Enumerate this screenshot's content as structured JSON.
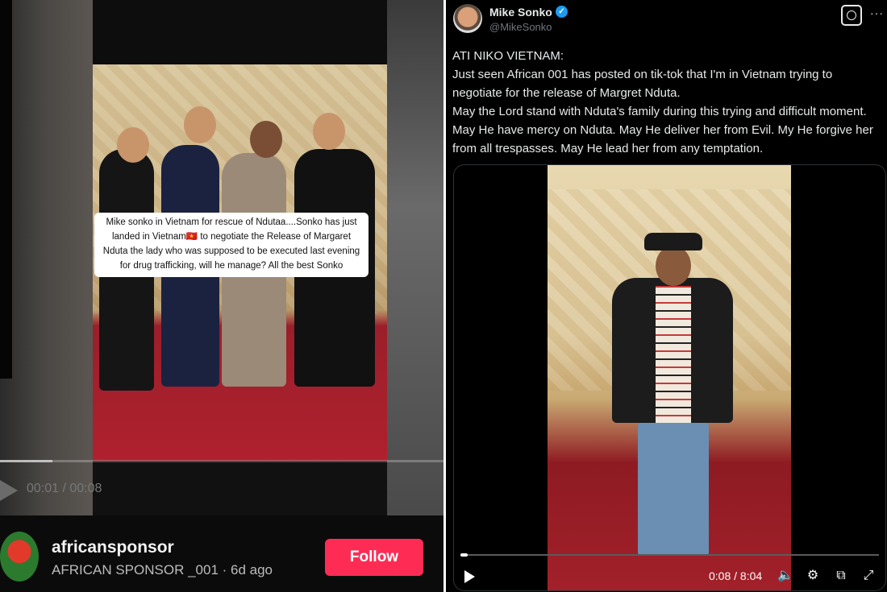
{
  "tiktok": {
    "caption": "Mike sonko in Vietnam  for rescue of Ndutaa....Sonko has just landed in Vietnam🇻🇳 to negotiate the Release of Margaret Nduta the lady who was supposed to be executed last evening for drug trafficking, will he manage? All the best Sonko",
    "time": "00:01 / 00:08",
    "progress_fraction": 0.125,
    "username": "africansponsor",
    "subline": "AFRICAN SPONSOR _001 · 6d ago",
    "follow_label": "Follow",
    "follow_color": "#fe2c55"
  },
  "tweet": {
    "display_name": "Mike Sonko",
    "handle": "@MikeSonko",
    "verified_color": "#1d9bf0",
    "text": "ATI NIKO VIETNAM:\nJust seen African 001 has posted on tik-tok that I'm in Vietnam trying to negotiate for the release of Margret Nduta.\nMay the Lord stand with Nduta's family during this trying and difficult moment. May He have mercy on Nduta. May He deliver her from Evil. My He forgive her from all trespasses. May He lead her from any temptation.",
    "video_time": "0:08 / 8:04",
    "video_progress_fraction": 0.017
  }
}
